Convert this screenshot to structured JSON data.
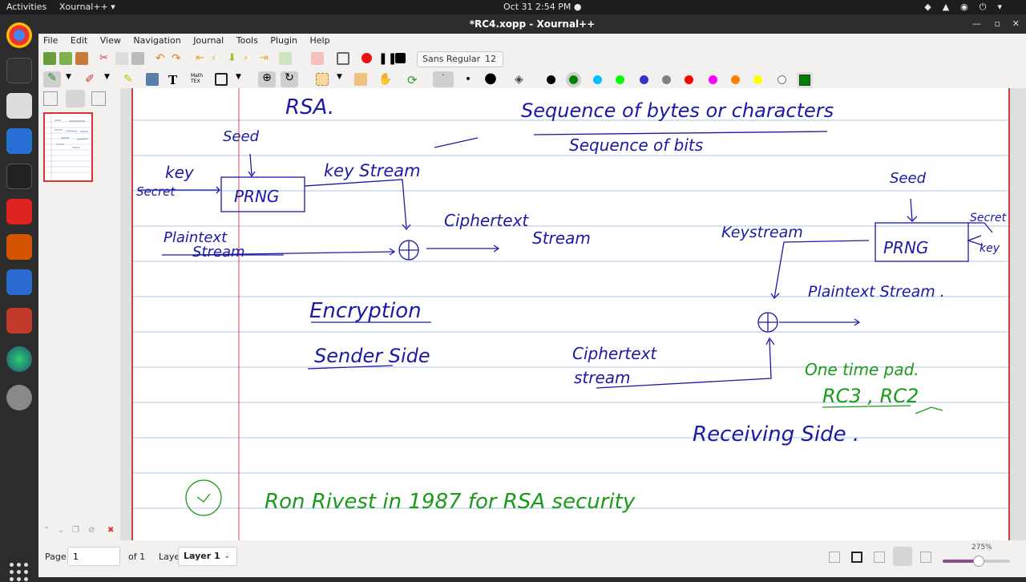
{
  "system": {
    "activities": "Activities",
    "app_menu": "Xournal++ ▾",
    "clock": "Oct 31  2:54 PM  ●"
  },
  "window": {
    "title": "*RC4.xopp - Xournal++"
  },
  "menu": [
    "File",
    "Edit",
    "View",
    "Navigation",
    "Journal",
    "Tools",
    "Plugin",
    "Help"
  ],
  "toolbar": {
    "font_name": "Sans Regular",
    "font_size": "12"
  },
  "palette": [
    "#000000",
    "#008000",
    "#00c0ff",
    "#00ff00",
    "#3333cc",
    "#808080",
    "#ff0000",
    "#ff00ff",
    "#ff8000",
    "#ffff00",
    "#ffffff",
    "#008000"
  ],
  "note": {
    "lines": [
      {
        "text": "RSA.",
        "color": "#1a1aa6"
      },
      {
        "text": "Sequence of bytes or characters",
        "color": "#1a1aa6"
      },
      {
        "text": "Sequence of bits",
        "color": "#1a1aa6"
      },
      {
        "text": "Seed",
        "color": "#1a1aa6"
      },
      {
        "text": "key",
        "color": "#1a1aa6"
      },
      {
        "text": "Secret",
        "color": "#1a1aa6"
      },
      {
        "text": "PRNG",
        "color": "#1a1aa6"
      },
      {
        "text": "key Stream",
        "color": "#1a1aa6"
      },
      {
        "text": "Ciphertext",
        "color": "#1a1aa6"
      },
      {
        "text": "Stream",
        "color": "#1a1aa6"
      },
      {
        "text": "Plaintext",
        "color": "#1a1aa6"
      },
      {
        "text": "Stream",
        "color": "#1a1aa6"
      },
      {
        "text": "Keystream",
        "color": "#1a1aa6"
      },
      {
        "text": "Seed",
        "color": "#1a1aa6"
      },
      {
        "text": "Secret",
        "color": "#1a1aa6"
      },
      {
        "text": "key",
        "color": "#1a1aa6"
      },
      {
        "text": "PRNG",
        "color": "#1a1aa6"
      },
      {
        "text": "Plaintext Stream .",
        "color": "#1a1aa6"
      },
      {
        "text": "Encryption",
        "color": "#1a1aa6"
      },
      {
        "text": "Sender Side",
        "color": "#1a1aa6"
      },
      {
        "text": "Ciphertext",
        "color": "#1a1aa6"
      },
      {
        "text": "stream",
        "color": "#1a1aa6"
      },
      {
        "text": "One time pad.",
        "color": "#1a9a1a"
      },
      {
        "text": "RC3 , RC2",
        "color": "#1a9a1a"
      },
      {
        "text": "Receiving Side .",
        "color": "#1a1aa6"
      },
      {
        "text": "Ron Rivest  in 1987  for RSA  security",
        "color": "#1a9a1a"
      }
    ]
  },
  "status": {
    "page_label": "Page",
    "page_value": "1",
    "of_label": "of 1",
    "layer_label": "Layer",
    "layer_value": "Layer 1",
    "zoom": "275%"
  }
}
